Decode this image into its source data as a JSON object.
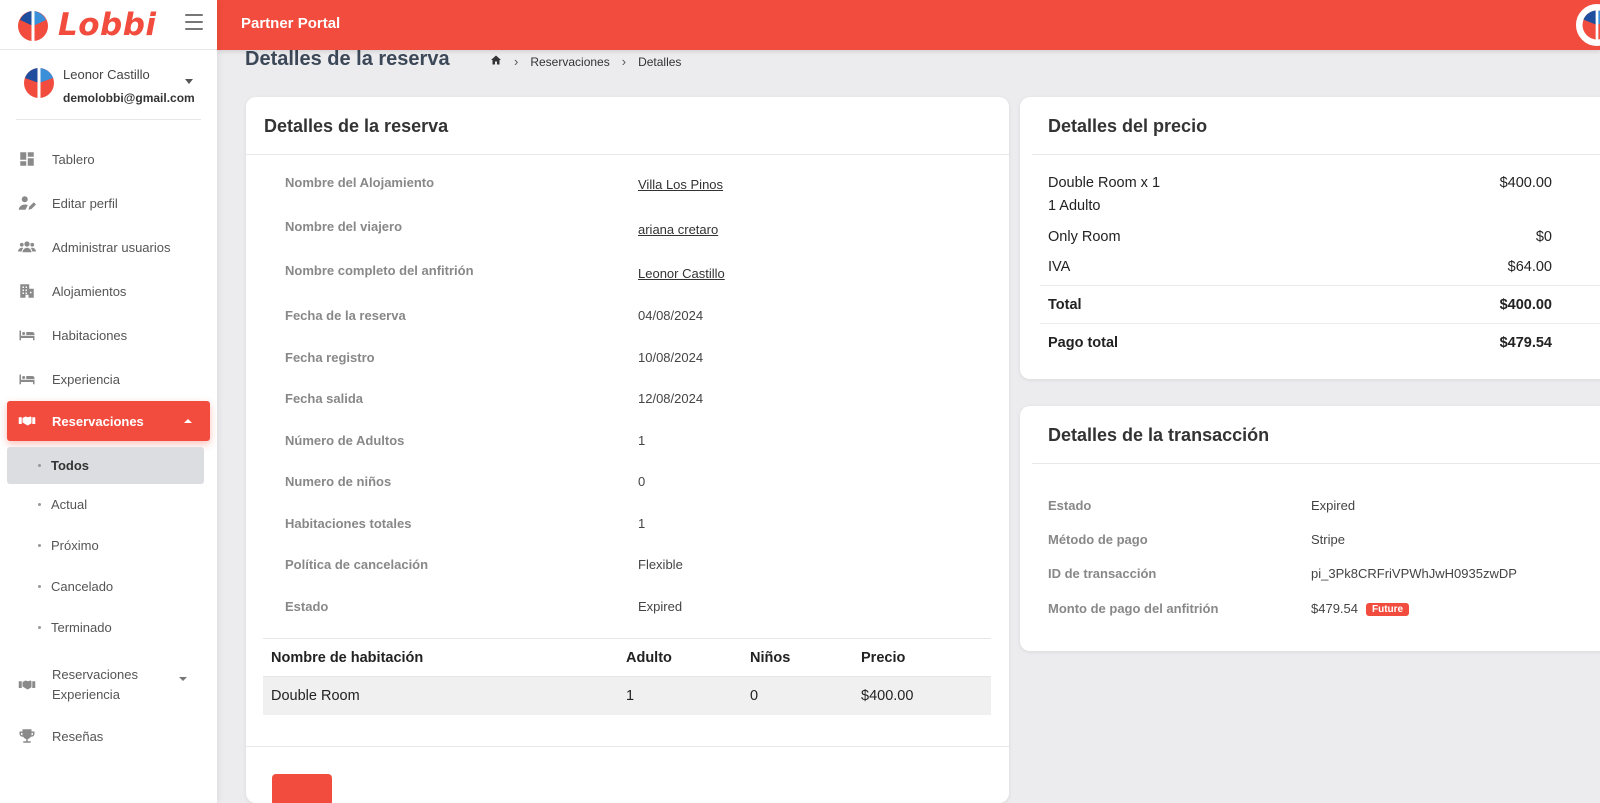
{
  "brand": {
    "name": "Lobbi"
  },
  "header": {
    "title": "Partner Portal"
  },
  "user": {
    "name": "Leonor Castillo",
    "email": "demolobbi@gmail.com"
  },
  "sidebar": {
    "items": [
      {
        "label": "Tablero",
        "icon": "dashboard-icon"
      },
      {
        "label": "Editar perfil",
        "icon": "edit-user-icon"
      },
      {
        "label": "Administrar usuarios",
        "icon": "users-icon"
      },
      {
        "label": "Alojamientos",
        "icon": "building-icon"
      },
      {
        "label": "Habitaciones",
        "icon": "bed-icon"
      },
      {
        "label": "Experiencia",
        "icon": "bed-icon"
      },
      {
        "label": "Reservaciones",
        "icon": "handshake-icon",
        "active": true
      },
      {
        "label": "Reservaciones Experiencia",
        "icon": "handshake-icon"
      },
      {
        "label": "Reseñas",
        "icon": "trophy-icon"
      }
    ],
    "subitems": [
      "Todos",
      "Actual",
      "Próximo",
      "Cancelado",
      "Terminado"
    ]
  },
  "page": {
    "title": "Detalles de la reserva",
    "breadcrumb": [
      "Reservaciones",
      "Detalles"
    ]
  },
  "reserva": {
    "title": "Detalles de la reserva",
    "rows": [
      {
        "label": "Nombre del Alojamiento",
        "value": "Villa Los Pinos"
      },
      {
        "label": "Nombre del viajero",
        "value": "ariana cretaro"
      },
      {
        "label": "Nombre completo del anfitrión",
        "value": "Leonor Castillo"
      },
      {
        "label": "Fecha de la reserva",
        "value": "04/08/2024"
      },
      {
        "label": "Fecha registro",
        "value": "10/08/2024"
      },
      {
        "label": "Fecha salida",
        "value": "12/08/2024"
      },
      {
        "label": "Número de Adultos",
        "value": "1"
      },
      {
        "label": "Numero de niños",
        "value": "0"
      },
      {
        "label": "Habitaciones totales",
        "value": "1"
      },
      {
        "label": "Política de cancelación",
        "value": "Flexible"
      },
      {
        "label": "Estado",
        "value": "Expired"
      }
    ],
    "table": {
      "headers": [
        "Nombre de habitación",
        "Adulto",
        "Niños",
        "Precio"
      ],
      "rows": [
        [
          "Double Room",
          "1",
          "0",
          "$400.00"
        ]
      ]
    }
  },
  "precio": {
    "title": "Detalles del precio",
    "room_label": "Double Room x 1",
    "room_sub": "1 Adulto",
    "room_value": "$400.00",
    "only_room_label": "Only Room",
    "only_room_value": "$0",
    "iva_label": "IVA",
    "iva_value": "$64.00",
    "total_label": "Total",
    "total_value": "$400.00",
    "pago_label": "Pago total",
    "pago_value": "$479.54"
  },
  "transaccion": {
    "title": "Detalles de la transacción",
    "estado_label": "Estado",
    "estado_value": "Expired",
    "metodo_label": "Método de pago",
    "metodo_value": "Stripe",
    "id_label": "ID de transacción",
    "id_value": "pi_3Pk8CRFriVPWhJwH0935zwDP",
    "monto_label": "Monto de pago del anfitrión",
    "monto_value": "$479.54",
    "monto_badge": "Future"
  },
  "colors": {
    "accent": "#f14c3d",
    "background": "#ececef"
  }
}
